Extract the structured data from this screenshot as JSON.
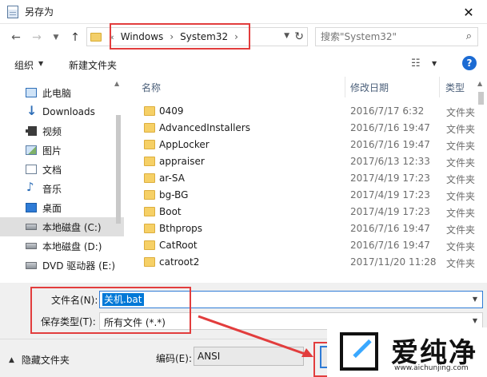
{
  "window": {
    "title": "另存为",
    "close_symbol": "✕"
  },
  "navigation": {
    "breadcrumb_overflow": "«",
    "breadcrumb": [
      "Windows",
      "System32"
    ],
    "breadcrumb_separator": "›",
    "search_placeholder": "搜索\"System32\""
  },
  "toolbar": {
    "organize_label": "组织",
    "new_folder_label": "新建文件夹"
  },
  "sidebar": {
    "items": [
      {
        "label": "此电脑",
        "icon": "pc-icon"
      },
      {
        "label": "Downloads",
        "icon": "download-icon"
      },
      {
        "label": "视频",
        "icon": "video-icon"
      },
      {
        "label": "图片",
        "icon": "pictures-icon"
      },
      {
        "label": "文档",
        "icon": "documents-icon"
      },
      {
        "label": "音乐",
        "icon": "music-icon"
      },
      {
        "label": "桌面",
        "icon": "desktop-icon"
      },
      {
        "label": "本地磁盘 (C:)",
        "icon": "drive-icon",
        "selected": true
      },
      {
        "label": "本地磁盘 (D:)",
        "icon": "drive-icon"
      },
      {
        "label": "DVD 驱动器 (E:)",
        "icon": "dvd-icon"
      }
    ]
  },
  "file_list": {
    "columns": [
      "名称",
      "修改日期",
      "类型"
    ],
    "rows": [
      {
        "name": "0409",
        "date": "2016/7/17 6:32",
        "type": "文件夹"
      },
      {
        "name": "AdvancedInstallers",
        "date": "2016/7/16 19:47",
        "type": "文件夹"
      },
      {
        "name": "AppLocker",
        "date": "2016/7/16 19:47",
        "type": "文件夹"
      },
      {
        "name": "appraiser",
        "date": "2017/6/13 12:33",
        "type": "文件夹"
      },
      {
        "name": "ar-SA",
        "date": "2017/4/19 17:23",
        "type": "文件夹"
      },
      {
        "name": "bg-BG",
        "date": "2017/4/19 17:23",
        "type": "文件夹"
      },
      {
        "name": "Boot",
        "date": "2017/4/19 17:23",
        "type": "文件夹"
      },
      {
        "name": "Bthprops",
        "date": "2016/7/16 19:47",
        "type": "文件夹"
      },
      {
        "name": "CatRoot",
        "date": "2016/7/16 19:47",
        "type": "文件夹"
      },
      {
        "name": "catroot2",
        "date": "2017/11/20 11:28",
        "type": "文件夹"
      }
    ]
  },
  "form": {
    "filename_label": "文件名(N):",
    "filename_value": "关机.bat",
    "filetype_label": "保存类型(T):",
    "filetype_value": "所有文件  (*.*)",
    "encoding_label": "编码(E):",
    "encoding_value": "ANSI"
  },
  "footer": {
    "hide_folders_label": "隐藏文件夹"
  },
  "watermark": {
    "name": "爱纯净",
    "url": "www.aichunjing.com"
  },
  "colors": {
    "annotation_red": "#e23d3d",
    "selection_blue": "#0078d7",
    "help_blue": "#1c6bd3"
  }
}
